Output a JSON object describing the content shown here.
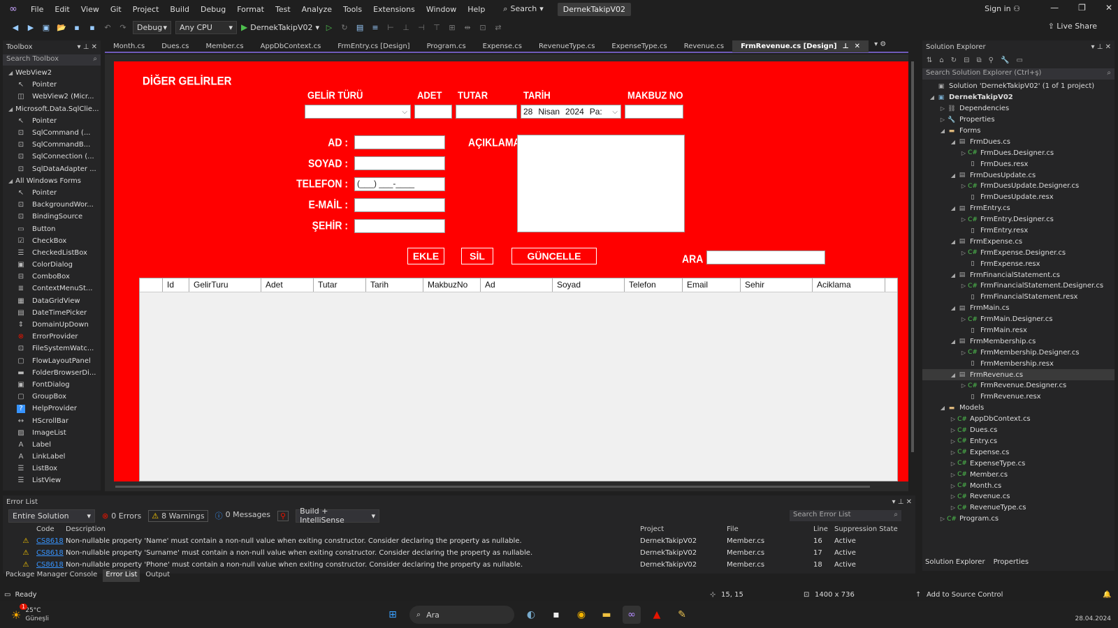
{
  "menu": {
    "items": [
      "File",
      "Edit",
      "View",
      "Git",
      "Project",
      "Build",
      "Debug",
      "Format",
      "Test",
      "Analyze",
      "Tools",
      "Extensions",
      "Window",
      "Help"
    ],
    "search": "Search",
    "solution_name": "DernekTakipV02",
    "sign_in": "Sign in"
  },
  "toolbar": {
    "config": "Debug",
    "platform": "Any CPU",
    "run_target": "DernekTakipV02",
    "live_share": "Live Share"
  },
  "toolbox": {
    "title": "Toolbox",
    "search_placeholder": "Search Toolbox",
    "items": [
      {
        "label": "WebView2",
        "group": true
      },
      {
        "label": "Pointer",
        "icon": "pointer-icon"
      },
      {
        "label": "WebView2 (Micr...",
        "icon": "webview-icon"
      },
      {
        "label": "Microsoft.Data.SqlClie...",
        "group": true
      },
      {
        "label": "Pointer",
        "icon": "pointer-icon"
      },
      {
        "label": "SqlCommand (...",
        "icon": "component-icon"
      },
      {
        "label": "SqlCommandB...",
        "icon": "component-icon"
      },
      {
        "label": "SqlConnection (...",
        "icon": "component-icon"
      },
      {
        "label": "SqlDataAdapter ...",
        "icon": "component-icon"
      },
      {
        "label": "All Windows Forms",
        "group": true
      },
      {
        "label": "Pointer",
        "icon": "pointer-icon"
      },
      {
        "label": "BackgroundWor...",
        "icon": "component-icon"
      },
      {
        "label": "BindingSource",
        "icon": "component-icon"
      },
      {
        "label": "Button",
        "icon": "button-icon"
      },
      {
        "label": "CheckBox",
        "icon": "checkbox-icon"
      },
      {
        "label": "CheckedListBox",
        "icon": "list-icon"
      },
      {
        "label": "ColorDialog",
        "icon": "dialog-icon"
      },
      {
        "label": "ComboBox",
        "icon": "combo-icon"
      },
      {
        "label": "ContextMenuSt...",
        "icon": "menu-icon"
      },
      {
        "label": "DataGridView",
        "icon": "grid-icon"
      },
      {
        "label": "DateTimePicker",
        "icon": "calendar-icon"
      },
      {
        "label": "DomainUpDown",
        "icon": "updown-icon"
      },
      {
        "label": "ErrorProvider",
        "icon": "error-icon"
      },
      {
        "label": "FileSystemWatc...",
        "icon": "component-icon"
      },
      {
        "label": "FlowLayoutPanel",
        "icon": "panel-icon"
      },
      {
        "label": "FolderBrowserDi...",
        "icon": "folder-icon"
      },
      {
        "label": "FontDialog",
        "icon": "dialog-icon"
      },
      {
        "label": "GroupBox",
        "icon": "panel-icon"
      },
      {
        "label": "HelpProvider",
        "icon": "help-icon"
      },
      {
        "label": "HScrollBar",
        "icon": "scroll-icon"
      },
      {
        "label": "ImageList",
        "icon": "image-icon"
      },
      {
        "label": "Label",
        "icon": "label-icon"
      },
      {
        "label": "LinkLabel",
        "icon": "label-icon"
      },
      {
        "label": "ListBox",
        "icon": "list-icon"
      },
      {
        "label": "ListView",
        "icon": "list-icon"
      }
    ]
  },
  "tabs": [
    "Month.cs",
    "Dues.cs",
    "Member.cs",
    "AppDbContext.cs",
    "FrmEntry.cs [Design]",
    "Program.cs",
    "Expense.cs",
    "RevenueType.cs",
    "ExpenseType.cs",
    "Revenue.cs"
  ],
  "active_tab": "FrmRevenue.cs [Design]",
  "form": {
    "title": "DİĞER GELİRLER",
    "gelir_turu_label": "GELİR TÜRÜ",
    "adet_label": "ADET",
    "tutar_label": "TUTAR",
    "tarih_label": "TARİH",
    "makbuz_label": "MAKBUZ NO",
    "date_day": "28",
    "date_month": "Nisan",
    "date_year": "2024",
    "date_weekday": "Pa:",
    "ad_label": "AD :",
    "soyad_label": "SOYAD :",
    "telefon_label": "TELEFON :",
    "telefon_mask": "(___) ___-____",
    "email_label": "E-MAİL :",
    "sehir_label": "ŞEHİR :",
    "aciklama_label": "AÇIKLAMA :",
    "ekle": "EKLE",
    "sil": "SİL",
    "guncelle": "GÜNCELLE",
    "ara_label": "ARA",
    "grid_columns": [
      "",
      "Id",
      "GelirTuru",
      "Adet",
      "Tutar",
      "Tarih",
      "MakbuzNo",
      "Ad",
      "Soyad",
      "Telefon",
      "Email",
      "Sehir",
      "Aciklama"
    ]
  },
  "solution_explorer": {
    "title": "Solution Explorer",
    "search_placeholder": "Search Solution Explorer (Ctrl+ş)",
    "items": [
      {
        "label": "Solution 'DernekTakipV02' (1 of 1 project)",
        "level": 0,
        "icon": "solution-icon",
        "exp": ""
      },
      {
        "label": "DernekTakipV02",
        "level": 0,
        "icon": "project-icon",
        "exp": "◢",
        "bold": true
      },
      {
        "label": "Dependencies",
        "level": 1,
        "icon": "dependencies-icon",
        "exp": "▷"
      },
      {
        "label": "Properties",
        "level": 1,
        "icon": "properties-icon",
        "exp": "▷"
      },
      {
        "label": "Forms",
        "level": 1,
        "icon": "folder-icon",
        "exp": "◢"
      },
      {
        "label": "FrmDues.cs",
        "level": 2,
        "icon": "form-icon",
        "exp": "◢"
      },
      {
        "label": "FrmDues.Designer.cs",
        "level": 3,
        "icon": "csharp-icon",
        "exp": "▷"
      },
      {
        "label": "FrmDues.resx",
        "level": 3,
        "icon": "resx-icon",
        "exp": ""
      },
      {
        "label": "FrmDuesUpdate.cs",
        "level": 2,
        "icon": "form-icon",
        "exp": "◢"
      },
      {
        "label": "FrmDuesUpdate.Designer.cs",
        "level": 3,
        "icon": "csharp-icon",
        "exp": "▷"
      },
      {
        "label": "FrmDuesUpdate.resx",
        "level": 3,
        "icon": "resx-icon",
        "exp": ""
      },
      {
        "label": "FrmEntry.cs",
        "level": 2,
        "icon": "form-icon",
        "exp": "◢"
      },
      {
        "label": "FrmEntry.Designer.cs",
        "level": 3,
        "icon": "csharp-icon",
        "exp": "▷"
      },
      {
        "label": "FrmEntry.resx",
        "level": 3,
        "icon": "resx-icon",
        "exp": ""
      },
      {
        "label": "FrmExpense.cs",
        "level": 2,
        "icon": "form-icon",
        "exp": "◢"
      },
      {
        "label": "FrmExpense.Designer.cs",
        "level": 3,
        "icon": "csharp-icon",
        "exp": "▷"
      },
      {
        "label": "FrmExpense.resx",
        "level": 3,
        "icon": "resx-icon",
        "exp": ""
      },
      {
        "label": "FrmFinancialStatement.cs",
        "level": 2,
        "icon": "form-icon",
        "exp": "◢"
      },
      {
        "label": "FrmFinancialStatement.Designer.cs",
        "level": 3,
        "icon": "csharp-icon",
        "exp": "▷"
      },
      {
        "label": "FrmFinancialStatement.resx",
        "level": 3,
        "icon": "resx-icon",
        "exp": ""
      },
      {
        "label": "FrmMain.cs",
        "level": 2,
        "icon": "form-icon",
        "exp": "◢"
      },
      {
        "label": "FrmMain.Designer.cs",
        "level": 3,
        "icon": "csharp-icon",
        "exp": "▷"
      },
      {
        "label": "FrmMain.resx",
        "level": 3,
        "icon": "resx-icon",
        "exp": ""
      },
      {
        "label": "FrmMembership.cs",
        "level": 2,
        "icon": "form-icon",
        "exp": "◢"
      },
      {
        "label": "FrmMembership.Designer.cs",
        "level": 3,
        "icon": "csharp-icon",
        "exp": "▷"
      },
      {
        "label": "FrmMembership.resx",
        "level": 3,
        "icon": "resx-icon",
        "exp": ""
      },
      {
        "label": "FrmRevenue.cs",
        "level": 2,
        "icon": "form-icon",
        "exp": "◢",
        "sel": true
      },
      {
        "label": "FrmRevenue.Designer.cs",
        "level": 3,
        "icon": "csharp-icon",
        "exp": "▷"
      },
      {
        "label": "FrmRevenue.resx",
        "level": 3,
        "icon": "resx-icon",
        "exp": ""
      },
      {
        "label": "Models",
        "level": 1,
        "icon": "folder-icon",
        "exp": "◢"
      },
      {
        "label": "AppDbContext.cs",
        "level": 2,
        "icon": "csharp-icon",
        "exp": "▷"
      },
      {
        "label": "Dues.cs",
        "level": 2,
        "icon": "csharp-icon",
        "exp": "▷"
      },
      {
        "label": "Entry.cs",
        "level": 2,
        "icon": "csharp-icon",
        "exp": "▷"
      },
      {
        "label": "Expense.cs",
        "level": 2,
        "icon": "csharp-icon",
        "exp": "▷"
      },
      {
        "label": "ExpenseType.cs",
        "level": 2,
        "icon": "csharp-icon",
        "exp": "▷"
      },
      {
        "label": "Member.cs",
        "level": 2,
        "icon": "csharp-icon",
        "exp": "▷"
      },
      {
        "label": "Month.cs",
        "level": 2,
        "icon": "csharp-icon",
        "exp": "▷"
      },
      {
        "label": "Revenue.cs",
        "level": 2,
        "icon": "csharp-icon",
        "exp": "▷"
      },
      {
        "label": "RevenueType.cs",
        "level": 2,
        "icon": "csharp-icon",
        "exp": "▷"
      },
      {
        "label": "Program.cs",
        "level": 1,
        "icon": "csharp-icon",
        "exp": "▷"
      }
    ],
    "footer_tabs": [
      "Solution Explorer",
      "Properties"
    ]
  },
  "error_list": {
    "title": "Error List",
    "scope": "Entire Solution",
    "errors": "0 Errors",
    "warnings": "8 Warnings",
    "messages": "0 Messages",
    "build_filter": "Build + IntelliSense",
    "search_placeholder": "Search Error List",
    "columns": [
      "Code",
      "Description",
      "Project",
      "File",
      "Line",
      "Suppression State"
    ],
    "rows": [
      {
        "code": "CS8618",
        "desc": "Non-nullable property 'Name' must contain a non-null value when exiting constructor. Consider declaring the property as nullable.",
        "project": "DernekTakipV02",
        "file": "Member.cs",
        "line": "16",
        "state": "Active"
      },
      {
        "code": "CS8618",
        "desc": "Non-nullable property 'Surname' must contain a non-null value when exiting constructor. Consider declaring the property as nullable.",
        "project": "DernekTakipV02",
        "file": "Member.cs",
        "line": "17",
        "state": "Active"
      },
      {
        "code": "CS8618",
        "desc": "Non-nullable property 'Phone' must contain a non-null value when exiting constructor. Consider declaring the property as nullable.",
        "project": "DernekTakipV02",
        "file": "Member.cs",
        "line": "18",
        "state": "Active"
      }
    ]
  },
  "bottom_tabs": [
    "Package Manager Console",
    "Error List",
    "Output"
  ],
  "status": {
    "ready": "Ready",
    "position": "15, 15",
    "size": "1400 x 736",
    "source_control": "Add to Source Control"
  },
  "taskbar": {
    "weather_temp": "25°C",
    "weather_desc": "Güneşli",
    "search": "Ara",
    "date": "28.04.2024",
    "notification_badge": "1"
  },
  "colors": {
    "form_bg": "#ff0000",
    "vs_accent": "#6e5ab8"
  }
}
